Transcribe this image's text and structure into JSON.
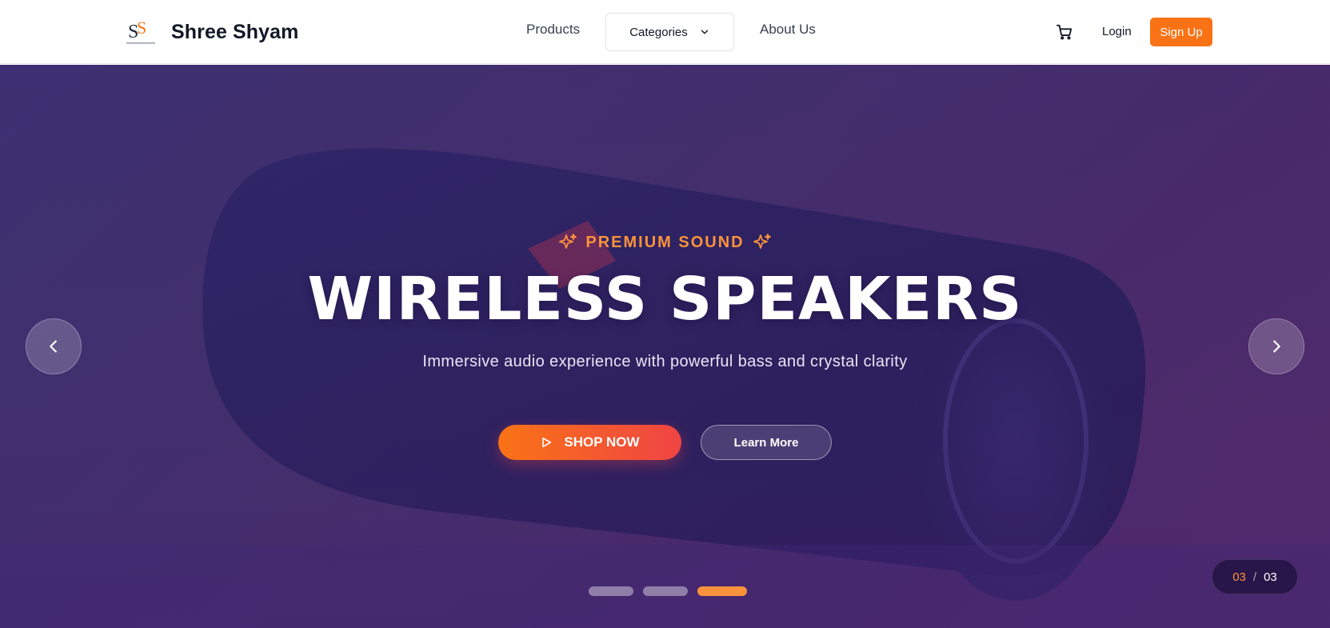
{
  "brand": {
    "name": "Shree Shyam",
    "logo_icon": "ss-monogram-logo"
  },
  "nav": {
    "products": "Products",
    "categories": "Categories",
    "about": "About Us",
    "cart_icon": "shopping-cart-icon",
    "login": "Login",
    "signup": "Sign Up"
  },
  "hero": {
    "eyebrow": "PREMIUM SOUND",
    "headline": "WIRELESS SPEAKERS",
    "subheadline": "Immersive audio experience with powerful bass and crystal clarity",
    "primary_cta": "SHOP NOW",
    "secondary_cta": "Learn More"
  },
  "carousel": {
    "current": "03",
    "separator": "/",
    "total": "03",
    "slide_count": 3,
    "active_index": 2
  },
  "colors": {
    "accent": "#f97316",
    "accent_gradient_end": "#ef4444",
    "eyebrow": "#fb923c",
    "hero_overlay": "#45306c"
  }
}
